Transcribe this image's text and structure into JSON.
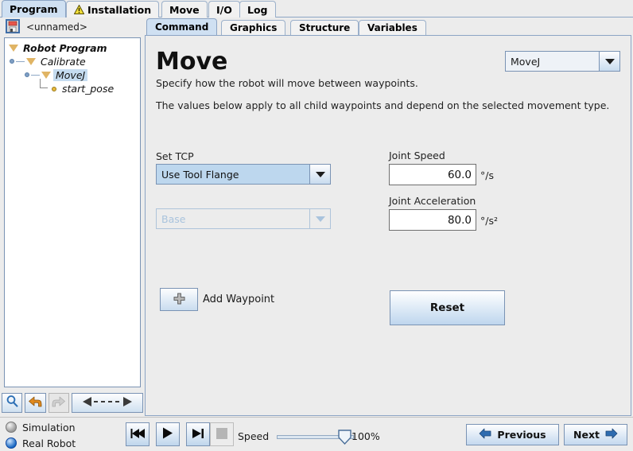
{
  "main_tabs": [
    {
      "label": "Program",
      "selected": true,
      "icon": null
    },
    {
      "label": "Installation",
      "selected": false,
      "icon": "warning-icon"
    },
    {
      "label": "Move",
      "selected": false,
      "icon": null
    },
    {
      "label": "I/O",
      "selected": false,
      "icon": null
    },
    {
      "label": "Log",
      "selected": false,
      "icon": null
    }
  ],
  "file": {
    "icon": "save-floppy-icon",
    "name": "<unnamed>"
  },
  "tree": {
    "items": [
      {
        "label": "Robot Program",
        "depth": 0,
        "bold": true,
        "marker": "triangle",
        "selected": false
      },
      {
        "label": "Calibrate",
        "depth": 1,
        "bold": false,
        "marker": "triangle",
        "selected": false
      },
      {
        "label": "MoveJ",
        "depth": 2,
        "bold": false,
        "marker": "triangle",
        "selected": true
      },
      {
        "label": "start_pose",
        "depth": 3,
        "bold": false,
        "marker": "dot",
        "selected": false
      }
    ]
  },
  "left_toolbar": [
    {
      "name": "search-button",
      "icon": "magnifier-icon",
      "enabled": true
    },
    {
      "name": "undo-button",
      "icon": "undo-arrow-icon",
      "enabled": true
    },
    {
      "name": "redo-button",
      "icon": "redo-arrow-icon",
      "enabled": false
    },
    {
      "name": "move-node-button",
      "icon": "move-left-right-icon",
      "enabled": true
    }
  ],
  "sub_tabs": [
    {
      "label": "Command",
      "selected": true
    },
    {
      "label": "Graphics",
      "selected": false
    },
    {
      "label": "Structure",
      "selected": false
    },
    {
      "label": "Variables",
      "selected": false
    }
  ],
  "command": {
    "title": "Move",
    "description_line1": "Specify how the robot will move between waypoints.",
    "description_line2": "The values below apply to all child waypoints and depend on the selected movement type.",
    "move_type": {
      "label": "move-type-select",
      "value": "MoveJ",
      "icon": "chevron-down-icon"
    },
    "tcp": {
      "label": "Set TCP",
      "value": "Use Tool Flange",
      "icon": "chevron-down-icon"
    },
    "feature": {
      "value": "Base",
      "disabled": true,
      "icon": "chevron-down-icon"
    },
    "joint_speed": {
      "label": "Joint Speed",
      "value": "60.0",
      "unit": "°/s"
    },
    "joint_acceleration": {
      "label": "Joint Acceleration",
      "value": "80.0",
      "unit": "°/s²"
    },
    "add_waypoint": {
      "icon": "plus-icon",
      "label": "Add Waypoint"
    },
    "reset_button": "Reset"
  },
  "status_bar": {
    "mode_options": [
      {
        "label": "Simulation",
        "selected": false
      },
      {
        "label": "Real Robot",
        "selected": true
      }
    ],
    "playback": [
      {
        "name": "rewind-button",
        "icon": "skip-back-icon",
        "enabled": true
      },
      {
        "name": "play-button",
        "icon": "play-icon",
        "enabled": true
      },
      {
        "name": "step-button",
        "icon": "skip-forward-icon",
        "enabled": true
      },
      {
        "name": "stop-button",
        "icon": "stop-square-icon",
        "enabled": false
      }
    ],
    "speed": {
      "label": "Speed",
      "value": "100%",
      "percent": 100
    },
    "previous_button": {
      "label": "Previous",
      "icon": "arrow-left-icon"
    },
    "next_button": {
      "label": "Next",
      "icon": "arrow-right-icon"
    }
  },
  "colors": {
    "tab_selected": "#cfe0f2",
    "panel_bg": "#ececec",
    "border": "#7a93b4",
    "combo_highlight": "#bdd7ee",
    "tree_selection": "#c5dcf0",
    "accent_triangle": "#e0b464"
  }
}
